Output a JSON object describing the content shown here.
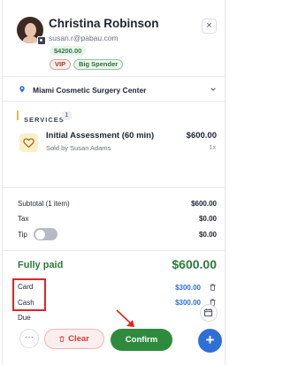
{
  "customer": {
    "name": "Christina Robinson",
    "email": "susan.r@pabau.com",
    "balance": "$4200.00",
    "tags": [
      "VIP",
      "Big Spender"
    ],
    "close_symbol": "×"
  },
  "location": {
    "name": "Miami Cosmetic Surgery Center",
    "icon": "map-pin-icon"
  },
  "services": {
    "header": "SERVICES",
    "count": "1",
    "items": [
      {
        "name": "Initial Assessment (60 min)",
        "staff": "Sold by Susan Adams",
        "price": "$600.00",
        "qty": "1x",
        "icon": "heart-icon"
      }
    ]
  },
  "totals": {
    "subtotal_label": "Subtotal (1 item)",
    "subtotal_value": "$600.00",
    "tax_label": "Tax",
    "tax_value": "$0.00",
    "tip_label": "Tip",
    "tip_value": "$0.00",
    "tip_enabled": false
  },
  "payment": {
    "status_label": "Fully paid",
    "status_value": "$600.00",
    "methods": [
      {
        "label": "Card",
        "value": "$300.00"
      },
      {
        "label": "Cash",
        "value": "$300.00"
      }
    ],
    "due_label": "Due"
  },
  "actions": {
    "more_label": "···",
    "clear_label": "Clear",
    "confirm_label": "Confirm",
    "fab_label": "+"
  },
  "colors": {
    "accent_green": "#2e8b3e",
    "accent_blue": "#2f6fd6",
    "danger_red": "#d23b3b",
    "annotation_red": "#e02424"
  }
}
